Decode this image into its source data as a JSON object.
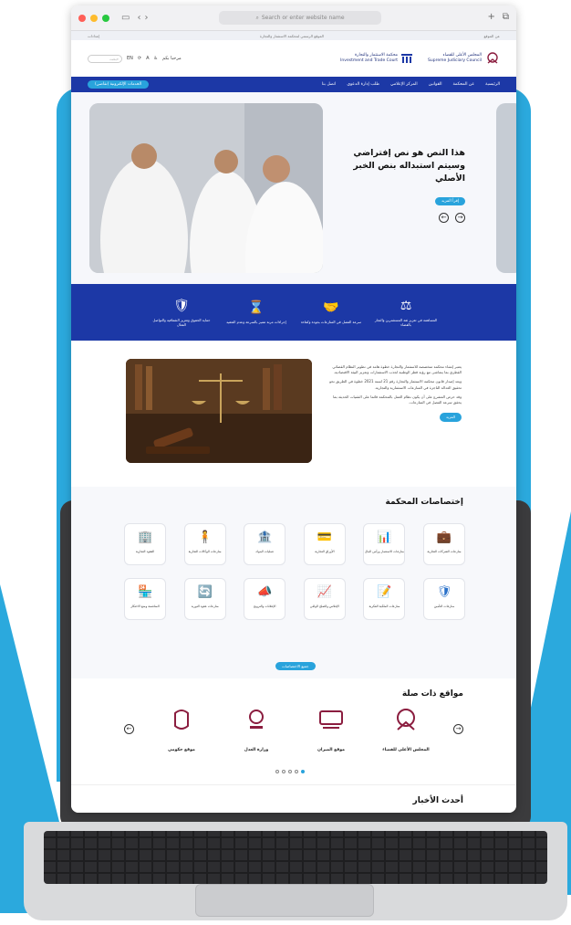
{
  "browser": {
    "url_placeholder": "Search or enter website name",
    "traffic_colors": [
      "#ff5f57",
      "#febc2e",
      "#28c840"
    ]
  },
  "utility_bar": {
    "right": "عن الموقع",
    "center": "الموقع الرسمي لمحكمة الاستثمار والتجارة",
    "left": "إعدادات"
  },
  "header": {
    "logo_ar": "المجلس الأعلى للقضاء",
    "logo_en": "Supreme Judiciary Council",
    "partner_ar": "محكمة الاستثمار والتجارة",
    "partner_en": "Investment and Trade Court",
    "user": "مرحبا بكم",
    "lang": "EN",
    "search_placeholder": "بحث"
  },
  "nav": {
    "items": [
      "الرئيسية",
      "عن المحكمة",
      "القوانين",
      "المركز الإعلامي",
      "طلب إدارة الدعوى",
      "اتصل بنا"
    ],
    "eservices": "الخدمات الإلكترونية (تقاضي)"
  },
  "hero": {
    "title": "هذا النص هو نص إفتراضي وسيتم استبداله بنص الخبر الأصلي",
    "more": "إقرأ المزيد"
  },
  "features": [
    {
      "icon": "⚖",
      "text": "المساهمة في تعزيز ثقة المستثمرين والتجار بالقضاء"
    },
    {
      "icon": "🤝",
      "text": "سرعة الفصل في المنازعات بجودة وكفاءة"
    },
    {
      "icon": "⌛",
      "text": "إجراءات مرنة تتميز بالسرعة وعدم التعقيد"
    },
    {
      "icon": "🛡",
      "text": "حماية الحقوق وتعزيز الشفافية والتواصل الفعال"
    }
  ],
  "about": {
    "p1": "يعتبر إنشاء محكمة متخصصة للاستثمار والتجارة خطوة هامة في تطوير النظام القضائي القطري بما يتماشى مع رؤية قطر الوطنية لجذب الاستثمارات وتعزيز البيئة الاقتصادية.",
    "p2": "ويعد إصدار قانون محكمة الاستثمار والتجارة رقم 21 لسنة 2021 خطوة في الطريق نحو تحقيق العدالة الناجزة في المنازعات الاستثمارية والتجارية.",
    "p3": "وقد حرص المشرع على أن يكون نظام العمل بالمحكمة قائما على التقنيات الحديثة بما يحقق سرعة الفصل في المنازعات.",
    "more": "المزيد"
  },
  "specialties": {
    "title": "إختصاصات المحكمة",
    "items": [
      {
        "icon": "💼",
        "label": "منازعات الشركات التجارية"
      },
      {
        "icon": "📊",
        "label": "منازعات الاستثمار ورأس المال"
      },
      {
        "icon": "💳",
        "label": "الأوراق التجارية"
      },
      {
        "icon": "🏦",
        "label": "عمليات البنوك"
      },
      {
        "icon": "🧍",
        "label": "منازعات الوكالات التجارية"
      },
      {
        "icon": "🏢",
        "label": "العقود التجارية"
      },
      {
        "icon": "🛡",
        "label": "منازعات التأمين"
      },
      {
        "icon": "📝",
        "label": "منازعات الملكية الفكرية"
      },
      {
        "icon": "📈",
        "label": "الإفلاس والصلح الواقي"
      },
      {
        "icon": "📣",
        "label": "الإعلانات والترويج"
      },
      {
        "icon": "🔄",
        "label": "منازعات عقود التوريد"
      },
      {
        "icon": "🏪",
        "label": "المنافسة ومنع الاحتكار"
      }
    ],
    "show_all": "جميع الاختصاصات"
  },
  "related": {
    "title": "مواقع ذات صلة",
    "sites": [
      {
        "name": "المجلس الأعلى للقضاء",
        "color": "#8b1d3f"
      },
      {
        "name": "موقع الميزان",
        "color": "#8b1d3f"
      },
      {
        "name": "وزارة العدل",
        "color": "#8b1d3f"
      },
      {
        "name": "موقع حكومي",
        "color": "#8b1d3f"
      }
    ]
  },
  "news": {
    "title": "أحدث الأخبار"
  },
  "colors": {
    "primary": "#1c38a6",
    "accent": "#29a3dc",
    "brand": "#8b1d3f"
  }
}
